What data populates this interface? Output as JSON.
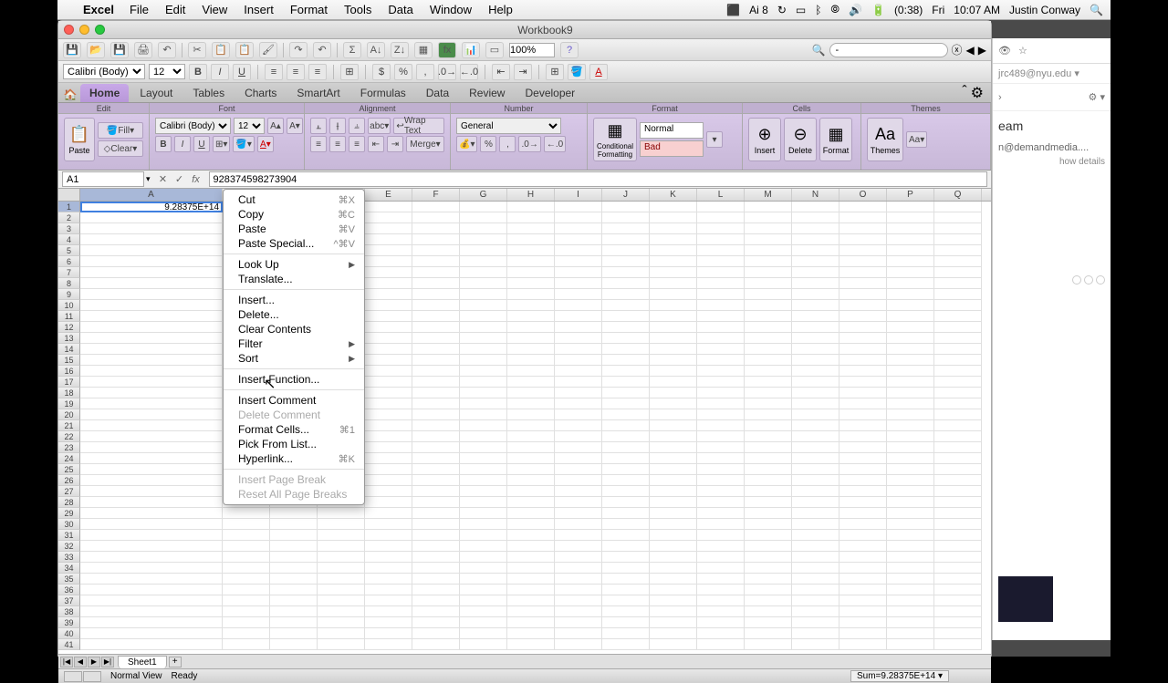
{
  "menubar": {
    "app": "Excel",
    "items": [
      "File",
      "Edit",
      "View",
      "Insert",
      "Format",
      "Tools",
      "Data",
      "Window",
      "Help"
    ],
    "right": {
      "battery": "(0:38)",
      "day": "Fri",
      "time": "10:07 AM",
      "user": "Justin Conway"
    }
  },
  "window": {
    "title": "Workbook9"
  },
  "qat": {
    "zoom": "100%",
    "search_value": "-"
  },
  "fontbar": {
    "font": "Calibri (Body)",
    "size": "12"
  },
  "tabs": [
    "Home",
    "Layout",
    "Tables",
    "Charts",
    "SmartArt",
    "Formulas",
    "Data",
    "Review",
    "Developer"
  ],
  "ribbon": {
    "groups": [
      "Edit",
      "Font",
      "Alignment",
      "Number",
      "Format",
      "Cells",
      "Themes"
    ],
    "paste": "Paste",
    "fill": "Fill",
    "clear": "Clear",
    "font2": "Calibri (Body)",
    "size2": "12",
    "wrap": "Wrap Text",
    "merge": "Merge",
    "numfmt": "General",
    "condfmt": "Conditional Formatting",
    "style_normal": "Normal",
    "style_bad": "Bad",
    "insert": "Insert",
    "delete": "Delete",
    "format": "Format",
    "themes": "Themes"
  },
  "namebox": "A1",
  "formula": "928374598273904",
  "cell_a1": "9.28375E+14",
  "columns": [
    "A",
    "B",
    "C",
    "D",
    "E",
    "F",
    "G",
    "H",
    "I",
    "J",
    "K",
    "L",
    "M",
    "N",
    "O",
    "P",
    "Q"
  ],
  "context_menu": {
    "cut": "Cut",
    "cut_k": "⌘X",
    "copy": "Copy",
    "copy_k": "⌘C",
    "paste": "Paste",
    "paste_k": "⌘V",
    "paste_special": "Paste Special...",
    "paste_special_k": "^⌘V",
    "lookup": "Look Up",
    "translate": "Translate...",
    "insert": "Insert...",
    "delete": "Delete...",
    "clear": "Clear Contents",
    "filter": "Filter",
    "sort": "Sort",
    "ins_fn": "Insert Function...",
    "ins_cmt": "Insert Comment",
    "del_cmt": "Delete Comment",
    "fmt_cells": "Format Cells...",
    "fmt_cells_k": "⌘1",
    "pick": "Pick From List...",
    "hyper": "Hyperlink...",
    "hyper_k": "⌘K",
    "ins_pb": "Insert Page Break",
    "reset_pb": "Reset All Page Breaks"
  },
  "sheet": {
    "name": "Sheet1"
  },
  "status": {
    "view": "Normal View",
    "ready": "Ready",
    "sum": "Sum=9.28375E+14"
  },
  "gmail": {
    "email": "jrc489@nyu.edu",
    "subject_part": "eam",
    "from_part": "n@demandmedia....",
    "details": "how details"
  }
}
